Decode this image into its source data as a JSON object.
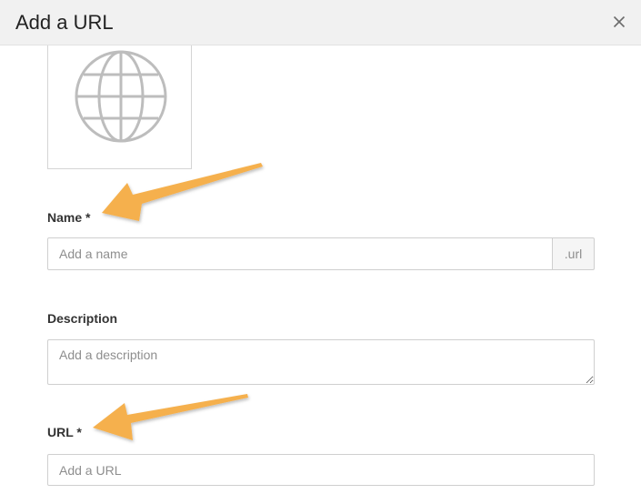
{
  "dialog": {
    "title": "Add a URL",
    "close_symbol": "×"
  },
  "icons": {
    "close": "close-icon",
    "preview": "globe-icon",
    "annotation": "arrow-icon"
  },
  "name_field": {
    "label": "Name *",
    "placeholder": "Add a name",
    "value": "",
    "suffix": ".url"
  },
  "description_field": {
    "label": "Description",
    "placeholder": "Add a description",
    "value": ""
  },
  "url_field": {
    "label": "URL *",
    "placeholder": "Add a URL",
    "value": ""
  },
  "colors": {
    "annotation_arrow": "#f5b04e",
    "header_bg": "#f1f1f1",
    "border": "#cfcfcf"
  }
}
